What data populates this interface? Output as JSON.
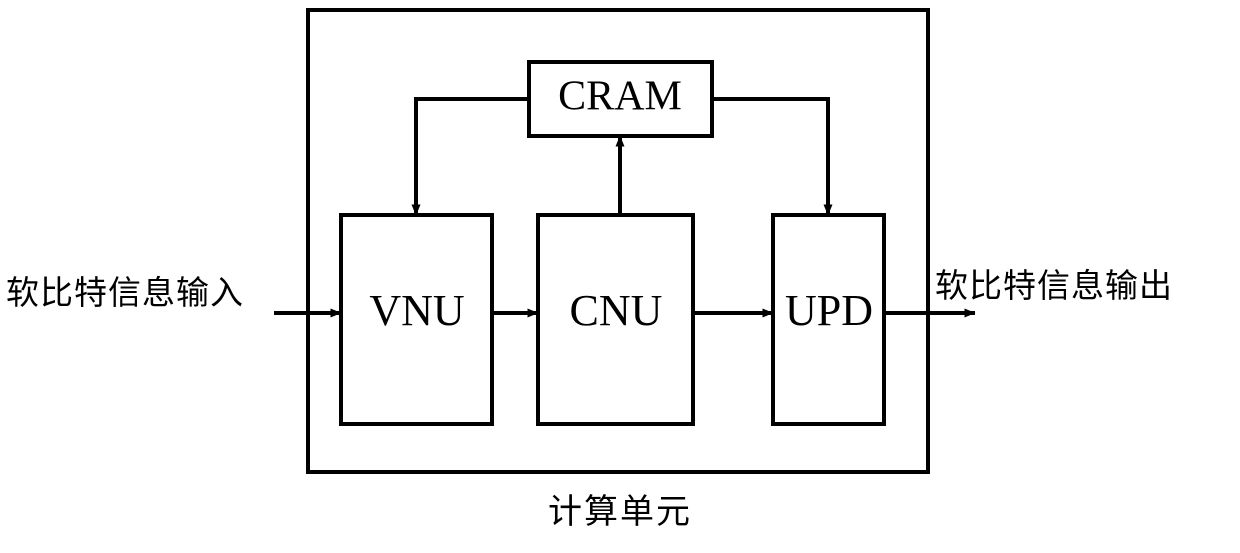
{
  "diagram": {
    "title": "计算单元",
    "outer_block": {
      "name": "计算单元",
      "caption": "计算单元"
    },
    "blocks": [
      {
        "id": "vnu",
        "label": "VNU"
      },
      {
        "id": "cnu",
        "label": "CNU"
      },
      {
        "id": "upd",
        "label": "UPD"
      },
      {
        "id": "cram",
        "label": "CRAM"
      }
    ],
    "io": {
      "input_label": "软比特信息输入",
      "output_label": "软比特信息输出"
    },
    "connections": [
      {
        "id": "in-to-vnu",
        "from": "input",
        "to": "vnu",
        "arrow": true
      },
      {
        "id": "vnu-to-cnu",
        "from": "vnu",
        "to": "cnu",
        "arrow": true
      },
      {
        "id": "cnu-to-upd",
        "from": "cnu",
        "to": "upd",
        "arrow": true
      },
      {
        "id": "upd-to-out",
        "from": "upd",
        "to": "output",
        "arrow": true
      },
      {
        "id": "cnu-to-cram",
        "from": "cnu",
        "to": "cram",
        "arrow": true
      },
      {
        "id": "cram-to-vnu",
        "from": "cram",
        "to": "vnu",
        "arrow": true
      },
      {
        "id": "cram-to-upd",
        "from": "cram",
        "to": "upd",
        "arrow": true
      }
    ],
    "colors": {
      "stroke": "#000000",
      "fill": "#ffffff",
      "background": "#ffffff"
    }
  }
}
